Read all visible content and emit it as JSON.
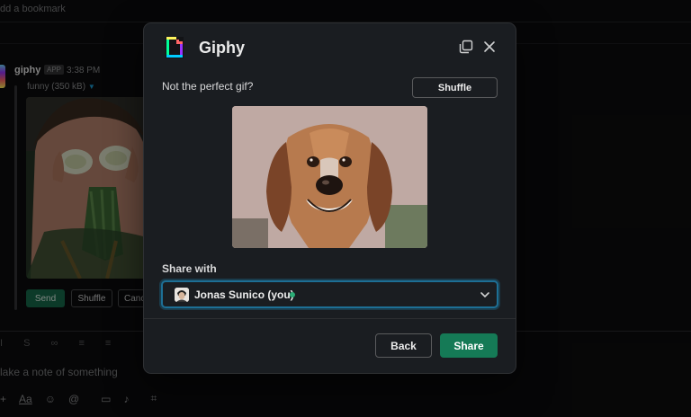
{
  "background": {
    "bookmark_text": "dd a bookmark",
    "message": {
      "sender": "giphy",
      "badge": "APP",
      "time": "3:38 PM",
      "query": "funny (350 kB)",
      "buttons": {
        "send": "Send",
        "shuffle": "Shuffle",
        "cancel": "Canc"
      }
    },
    "composer": {
      "placeholder": "lake a note of something",
      "format_label": "Aa"
    }
  },
  "modal": {
    "title": "Giphy",
    "prompt": "Not the perfect gif?",
    "shuffle_label": "Shuffle",
    "share_with_label": "Share with",
    "selected_user": "Jonas Sunico (you)",
    "presence": "active",
    "back_label": "Back",
    "share_label": "Share"
  },
  "colors": {
    "accent_green": "#157a56",
    "focus_blue": "#1d6f95",
    "presence_green": "#2bac76",
    "modal_bg": "#1a1d21"
  },
  "icons": [
    "giphy-logo-icon",
    "expand-icon",
    "close-icon",
    "chevron-down-icon"
  ]
}
